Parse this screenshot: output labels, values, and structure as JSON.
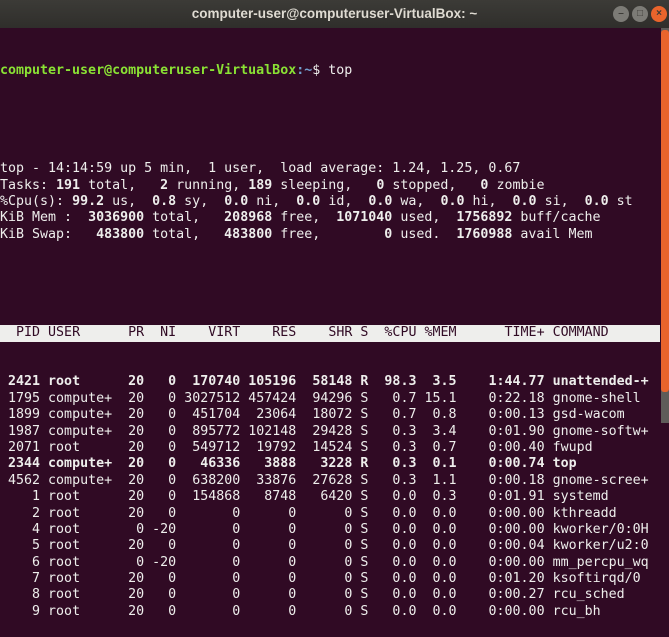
{
  "window": {
    "title": "computer-user@computeruser-VirtualBox: ~",
    "minimize": "–",
    "maximize": "□",
    "close": "×"
  },
  "prompt": {
    "user_host": "computer-user@computeruser-VirtualBox",
    "path": ":~",
    "symbol": "$ ",
    "command": "top"
  },
  "summary": [
    [
      {
        "t": "top - 14:14:59 up 5 min,  1 user,  load average: 1.24, 1.25, 0.67"
      }
    ],
    [
      {
        "t": "Tasks: "
      },
      {
        "t": "191",
        "b": 1
      },
      {
        "t": " total,   "
      },
      {
        "t": "2",
        "b": 1
      },
      {
        "t": " running, "
      },
      {
        "t": "189",
        "b": 1
      },
      {
        "t": " sleeping,   "
      },
      {
        "t": "0",
        "b": 1
      },
      {
        "t": " stopped,   "
      },
      {
        "t": "0",
        "b": 1
      },
      {
        "t": " zombie"
      }
    ],
    [
      {
        "t": "%Cpu(s): "
      },
      {
        "t": "99.2",
        "b": 1
      },
      {
        "t": " us,  "
      },
      {
        "t": "0.8",
        "b": 1
      },
      {
        "t": " sy,  "
      },
      {
        "t": "0.0",
        "b": 1
      },
      {
        "t": " ni,  "
      },
      {
        "t": "0.0",
        "b": 1
      },
      {
        "t": " id,  "
      },
      {
        "t": "0.0",
        "b": 1
      },
      {
        "t": " wa,  "
      },
      {
        "t": "0.0",
        "b": 1
      },
      {
        "t": " hi,  "
      },
      {
        "t": "0.0",
        "b": 1
      },
      {
        "t": " si,  "
      },
      {
        "t": "0.0",
        "b": 1
      },
      {
        "t": " st"
      }
    ],
    [
      {
        "t": "KiB Mem : "
      },
      {
        "t": " 3036900",
        "b": 1
      },
      {
        "t": " total,  "
      },
      {
        "t": " 208968",
        "b": 1
      },
      {
        "t": " free,  "
      },
      {
        "t": "1071040",
        "b": 1
      },
      {
        "t": " used,  "
      },
      {
        "t": "1756892",
        "b": 1
      },
      {
        "t": " buff/cache"
      }
    ],
    [
      {
        "t": "KiB Swap: "
      },
      {
        "t": "  483800",
        "b": 1
      },
      {
        "t": " total,  "
      },
      {
        "t": " 483800",
        "b": 1
      },
      {
        "t": " free,  "
      },
      {
        "t": "      0",
        "b": 1
      },
      {
        "t": " used.  "
      },
      {
        "t": "1760988",
        "b": 1
      },
      {
        "t": " avail Mem"
      }
    ]
  ],
  "table": {
    "columns": [
      "PID",
      "USER",
      "PR",
      "NI",
      "VIRT",
      "RES",
      "SHR",
      "S",
      "%CPU",
      "%MEM",
      "TIME+",
      "COMMAND"
    ],
    "rows": [
      {
        "bold": true,
        "v": [
          "2421",
          "root",
          "20",
          "0",
          "170740",
          "105196",
          "58148",
          "R",
          "98.3",
          "3.5",
          "1:44.77",
          "unattended-+"
        ]
      },
      {
        "v": [
          "1795",
          "compute+",
          "20",
          "0",
          "3027512",
          "457424",
          "94296",
          "S",
          "0.7",
          "15.1",
          "0:22.18",
          "gnome-shell"
        ]
      },
      {
        "v": [
          "1899",
          "compute+",
          "20",
          "0",
          "451704",
          "23064",
          "18072",
          "S",
          "0.7",
          "0.8",
          "0:00.13",
          "gsd-wacom"
        ]
      },
      {
        "v": [
          "1987",
          "compute+",
          "20",
          "0",
          "895772",
          "102148",
          "29428",
          "S",
          "0.3",
          "3.4",
          "0:01.90",
          "gnome-softw+"
        ]
      },
      {
        "v": [
          "2071",
          "root",
          "20",
          "0",
          "549712",
          "19792",
          "14524",
          "S",
          "0.3",
          "0.7",
          "0:00.40",
          "fwupd"
        ]
      },
      {
        "bold": true,
        "v": [
          "2344",
          "compute+",
          "20",
          "0",
          "46336",
          "3888",
          "3228",
          "R",
          "0.3",
          "0.1",
          "0:00.74",
          "top"
        ]
      },
      {
        "v": [
          "4562",
          "compute+",
          "20",
          "0",
          "638200",
          "33876",
          "27628",
          "S",
          "0.3",
          "1.1",
          "0:00.18",
          "gnome-scree+"
        ]
      },
      {
        "v": [
          "1",
          "root",
          "20",
          "0",
          "154868",
          "8748",
          "6420",
          "S",
          "0.0",
          "0.3",
          "0:01.91",
          "systemd"
        ]
      },
      {
        "v": [
          "2",
          "root",
          "20",
          "0",
          "0",
          "0",
          "0",
          "S",
          "0.0",
          "0.0",
          "0:00.00",
          "kthreadd"
        ]
      },
      {
        "v": [
          "4",
          "root",
          "0",
          "-20",
          "0",
          "0",
          "0",
          "S",
          "0.0",
          "0.0",
          "0:00.00",
          "kworker/0:0H"
        ]
      },
      {
        "v": [
          "5",
          "root",
          "20",
          "0",
          "0",
          "0",
          "0",
          "S",
          "0.0",
          "0.0",
          "0:00.04",
          "kworker/u2:0"
        ]
      },
      {
        "v": [
          "6",
          "root",
          "0",
          "-20",
          "0",
          "0",
          "0",
          "S",
          "0.0",
          "0.0",
          "0:00.00",
          "mm_percpu_wq"
        ]
      },
      {
        "v": [
          "7",
          "root",
          "20",
          "0",
          "0",
          "0",
          "0",
          "S",
          "0.0",
          "0.0",
          "0:01.20",
          "ksoftirqd/0"
        ]
      },
      {
        "v": [
          "8",
          "root",
          "20",
          "0",
          "0",
          "0",
          "0",
          "S",
          "0.0",
          "0.0",
          "0:00.27",
          "rcu_sched"
        ]
      },
      {
        "v": [
          "9",
          "root",
          "20",
          "0",
          "0",
          "0",
          "0",
          "S",
          "0.0",
          "0.0",
          "0:00.00",
          "rcu_bh"
        ]
      }
    ]
  }
}
